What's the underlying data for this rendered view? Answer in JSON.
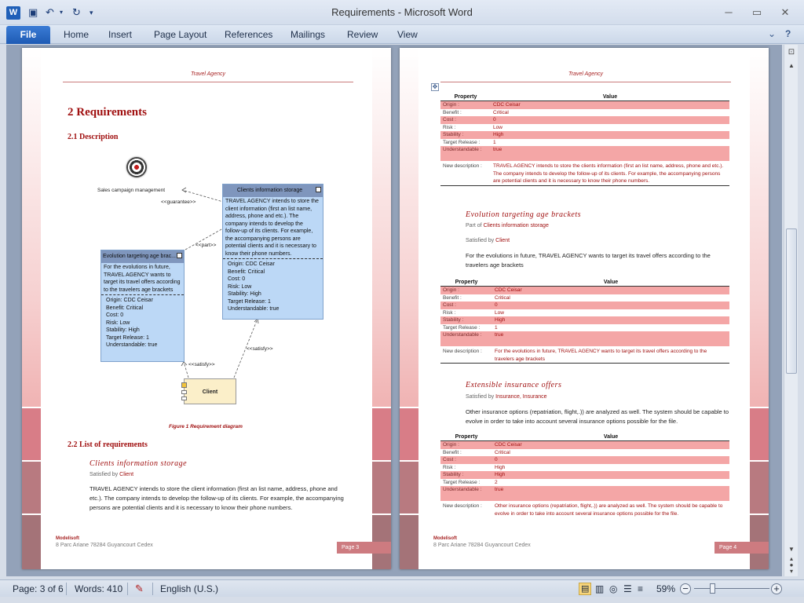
{
  "window": {
    "title": "Requirements  -  Microsoft Word",
    "app_icon": "W"
  },
  "qat": {
    "undo": "↶",
    "redo": "↻",
    "save": "💾",
    "more": "▾"
  },
  "ribbon": {
    "tabs": [
      "File",
      "Home",
      "Insert",
      "Page Layout",
      "References",
      "Mailings",
      "Review",
      "View"
    ]
  },
  "colors": {
    "accent": "#a01010",
    "table_pink": "#f4a6a6",
    "ribbon_blue": "#1e5bb4"
  },
  "page3": {
    "header": "Travel Agency",
    "h1": "2  Requirements",
    "h2_desc": "2.1    Description",
    "diagram": {
      "sales_label": "Sales campaign management",
      "guarantee": "<<guarantee>>",
      "part": "<<part>>",
      "satisfy1": "<<satisfy>>",
      "satisfy2": "<<satisfy>>",
      "client": "Client",
      "storage": {
        "title": "Clients information storage",
        "desc": "TRAVEL AGENCY intends to store the client information (first an list name, address, phone and etc.). The company intends to develop the follow-up of its clients. For example, the accompanying persons are potential clients and it is necessary to know their phone numbers.",
        "props": [
          "Origin: CDC Ceisar",
          "Benefit: Critical",
          "Cost: 0",
          "Risk: Low",
          "Stability: High",
          "Target Release: 1",
          "Understandable: true"
        ]
      },
      "evolution": {
        "title": "Evolution targeting age brac...",
        "desc": "For the evolutions in future, TRAVEL AGENCY wants to target its travel offers according to the travelers age brackets",
        "props": [
          "Origin: CDC Ceisar",
          "Benefit: Critical",
          "Cost: 0",
          "Risk: Low",
          "Stability: High",
          "Target Release: 1",
          "Understandable: true"
        ]
      }
    },
    "caption": "Figure 1 Requirement diagram",
    "h2_list": "2.2    List of requirements",
    "req_title": "Clients information storage",
    "satisfied_prefix": "Satisfied by ",
    "satisfied_link": "Client",
    "para": "TRAVEL AGENCY intends to store the client information (first an list name, address, phone and etc.). The company intends to develop the follow-up of its clients. For example, the accompanying persons are potential clients and it is necessary to know their phone numbers.",
    "footer_company": "Modelisoft",
    "footer_address": "8 Parc Ariane 78284 Guyancourt Cedex",
    "footer_page": "Page 3"
  },
  "page4": {
    "header": "Travel Agency",
    "table_headers": {
      "property": "Property",
      "value": "Value"
    },
    "table1": [
      [
        "Origin :",
        "CDC Ceisar"
      ],
      [
        "Benefit :",
        "Critical"
      ],
      [
        "Cost :",
        "0"
      ],
      [
        "Risk :",
        "Low"
      ],
      [
        "Stability :",
        "High"
      ],
      [
        "Target Release :",
        "1"
      ],
      [
        "Understandable :",
        "true"
      ],
      [
        "New description :",
        "TRAVEL AGENCY intends to store the clients information (first an list name, address, phone and etc.). The company intends to develop the follow-up of its clients. For example, the accompanying persons are potential clients and it is necessary to know their phone numbers."
      ]
    ],
    "req2_title": "Evolution targeting age brackets",
    "req2_part_prefix": "Part of ",
    "req2_part_link": "Clients information storage",
    "req2_sat_prefix": "Satisfied by ",
    "req2_sat_link": "Client",
    "req2_para": "For the evolutions in future, TRAVEL AGENCY wants to target its travel offers according to the travelers age brackets",
    "table2": [
      [
        "Origin :",
        "CDC Ceisar"
      ],
      [
        "Benefit :",
        "Critical"
      ],
      [
        "Cost :",
        "0"
      ],
      [
        "Risk :",
        "Low"
      ],
      [
        "Stability :",
        "High"
      ],
      [
        "Target Release :",
        "1"
      ],
      [
        "Understandable :",
        "true"
      ],
      [
        "New description :",
        "For the evolutions in future, TRAVEL AGENCY wants to target its travel offers according to the travelers age brackets"
      ]
    ],
    "req3_title": "Extensible insurance offers",
    "req3_sat_prefix": "Satisfied by ",
    "req3_sat_link": "Insurance, Insurance",
    "req3_para": "Other insurance options (repatriation, flight,.)) are analyzed as well. The system should be capable to evolve in order to take into account several insurance options possible for the file.",
    "table3": [
      [
        "Origin :",
        "CDC Ceisar"
      ],
      [
        "Benefit :",
        "Critical"
      ],
      [
        "Cost :",
        "0"
      ],
      [
        "Risk :",
        "High"
      ],
      [
        "Stability :",
        "High"
      ],
      [
        "Target Release :",
        "2"
      ],
      [
        "Understandable :",
        "true"
      ],
      [
        "New description :",
        "Other insurance options (repatriation, flight,.)) are analyzed as well. The system should be capable to evolve in order to take into account several insurance options possible for the file."
      ]
    ],
    "footer_company": "Modelisoft",
    "footer_address": "8 Parc Ariane 78284 Guyancourt Cedex",
    "footer_page": "Page 4"
  },
  "status": {
    "page": "Page: 3 of 6",
    "words": "Words: 410",
    "language": "English (U.S.)",
    "zoom": "59%",
    "zoom_fraction": 0.25
  }
}
